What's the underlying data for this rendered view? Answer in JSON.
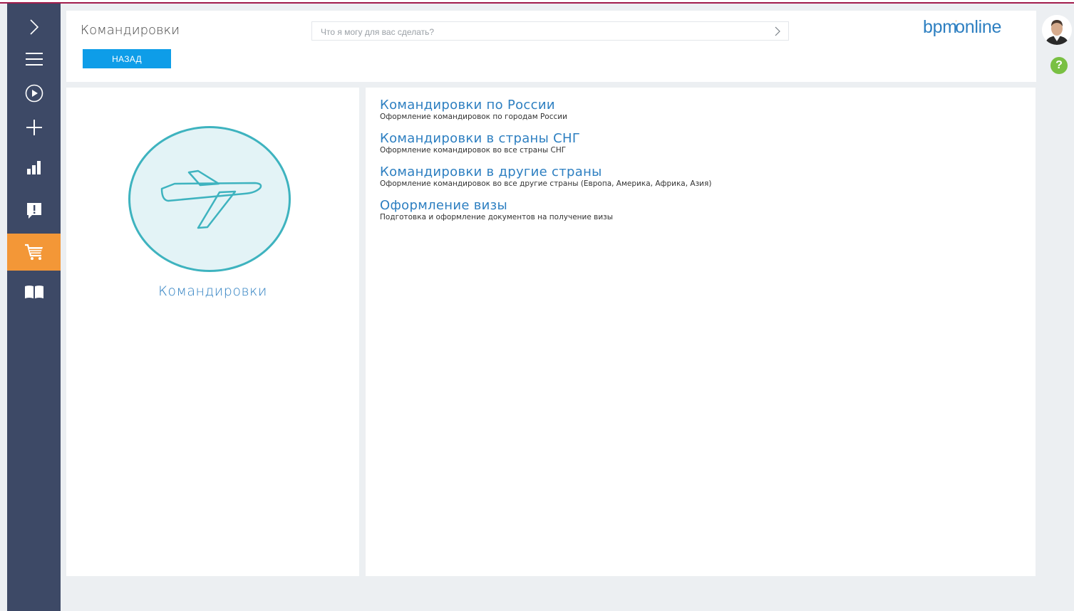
{
  "colors": {
    "accent_top": "#a21d4d",
    "sidebar_bg": "#3d4966",
    "sidebar_active": "#f39737",
    "primary_button": "#0e9de8",
    "link_blue": "#2d7fc1",
    "teal_circle": "#3eb3bf",
    "help_green": "#79c043"
  },
  "sidebar": {
    "items": [
      {
        "icon": "chevron-right-icon"
      },
      {
        "icon": "hamburger-menu-icon"
      },
      {
        "icon": "play-circle-icon"
      },
      {
        "icon": "plus-icon"
      },
      {
        "icon": "bar-chart-icon"
      },
      {
        "icon": "alert-message-icon"
      },
      {
        "icon": "cart-icon",
        "active": true
      },
      {
        "icon": "book-icon"
      }
    ]
  },
  "header": {
    "title": "Командировки",
    "back_label": "НАЗАД",
    "search_placeholder": "Что я могу для вас сделать?",
    "logo_left": "bpm",
    "logo_mark": "'",
    "logo_right": "online",
    "help_label": "?"
  },
  "catalog": {
    "title": "Командировки",
    "icon": "airplane-icon"
  },
  "services": [
    {
      "title": "Командировки по России",
      "desc": "Оформление командировок по городам России"
    },
    {
      "title": "Командировки в страны СНГ",
      "desc": "Оформление командировок во все страны СНГ"
    },
    {
      "title": "Командировки в другие страны",
      "desc": "Оформление командировок во все другие страны (Европа, Америка, Африка, Азия)"
    },
    {
      "title": "Оформление визы",
      "desc": "Подготовка и оформление документов на получение визы"
    }
  ]
}
